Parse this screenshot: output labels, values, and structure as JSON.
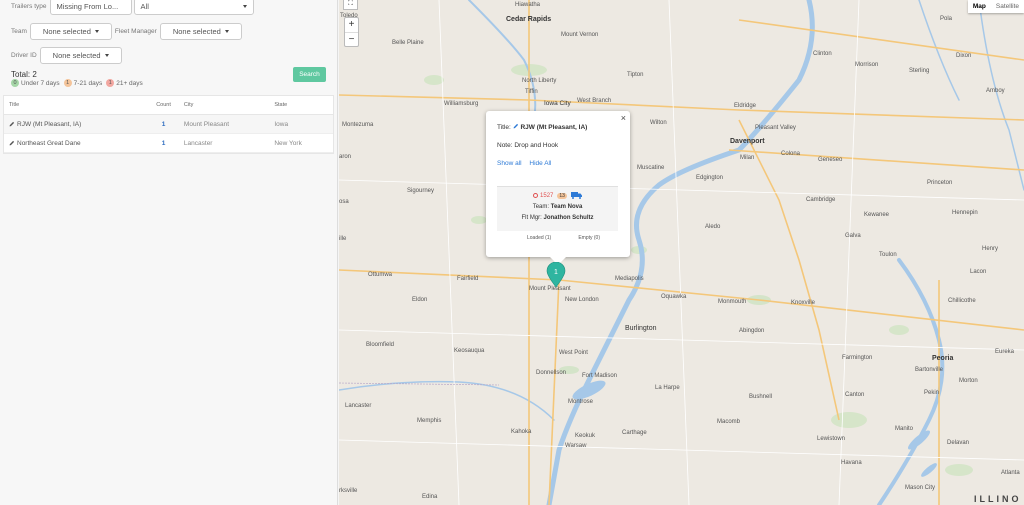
{
  "filters": {
    "trailers_type_label": "Trailers type",
    "trailers_type_value": "Missing From Lo...",
    "trailers_type_second_value": "All",
    "team_label": "Team",
    "team_value": "None selected",
    "fleet_manager_label": "Fleet Manager",
    "fleet_manager_value": "None selected",
    "driver_id_label": "Driver ID",
    "driver_id_value": "None selected",
    "search_button": "Search"
  },
  "summary": {
    "total": "Total: 2",
    "legend": [
      {
        "count": "0",
        "label": "Under 7 days"
      },
      {
        "count": "1",
        "label": "7-21 days"
      },
      {
        "count": "1",
        "label": "21+ days"
      }
    ]
  },
  "table": {
    "headers": [
      "Title",
      "Count",
      "City",
      "State"
    ],
    "rows": [
      {
        "title": "RJW (Mt Pleasant, IA)",
        "count": "1",
        "city": "Mount Pleasant",
        "state": "Iowa"
      },
      {
        "title": "Northeast Great Dane",
        "count": "1",
        "city": "Lancaster",
        "state": "New York"
      }
    ]
  },
  "map": {
    "map_button": "Map",
    "satellite_button": "Satellite",
    "zoom_in": "+",
    "zoom_out": "−",
    "fullscreen": "⛶",
    "pin_count": "1",
    "cities": {
      "hawatha": "Hiawatha",
      "cedar_rapids": "Cedar Rapids",
      "mount_vernon": "Mount Vernon",
      "belle_plaine": "Belle Plaine",
      "north_liberty": "North Liberty",
      "tiffin": "Tiffin",
      "iowa_city": "Iowa City",
      "west_branch": "West Branch",
      "tipton": "Tipton",
      "williamsburg": "Williamsburg",
      "montezuma": "Montezuma",
      "wilton": "Wilton",
      "eldridge": "Eldridge",
      "pleasant_valley": "Pleasant Valley",
      "davenport": "Davenport",
      "milan": "Milan",
      "colona": "Colona",
      "geneseo": "Geneseo",
      "muscatine": "Muscatine",
      "edgington": "Edgington",
      "sigourney": "Sigourney",
      "cambridge": "Cambridge",
      "kewanee": "Kewanee",
      "princeton": "Princeton",
      "hennepin": "Hennepin",
      "aledo": "Aledo",
      "galva": "Galva",
      "toulon": "Toulon",
      "henry": "Henry",
      "lacon": "Lacon",
      "ottumwa": "Ottumwa",
      "fairfield": "Fairfield",
      "mount_pleasant": "Mount Pleasant",
      "mediapolis": "Mediapolis",
      "new_london": "New London",
      "oquawka": "Oquawka",
      "monmouth": "Monmouth",
      "knoxville": "Knoxville",
      "chillicothe": "Chillicothe",
      "eldon": "Eldon",
      "burlington": "Burlington",
      "abingdon": "Abingdon",
      "bloomfield": "Bloomfield",
      "keosauqua": "Keosauqua",
      "west_point": "West Point",
      "farmington": "Farmington",
      "peoria": "Peoria",
      "eureka": "Eureka",
      "bartonville": "Bartonville",
      "donnellson": "Donnellson",
      "fort_madison": "Fort Madison",
      "la_harpe": "La Harpe",
      "canton": "Canton",
      "pekin": "Pekin",
      "morton": "Morton",
      "bushnell": "Bushnell",
      "montrose": "Montrose",
      "lancaster": "Lancaster",
      "memphis": "Memphis",
      "kahoka": "Kahoka",
      "keokuk": "Keokuk",
      "carthage": "Carthage",
      "macomb": "Macomb",
      "lewistown": "Lewistown",
      "manito": "Manito",
      "warsaw": "Warsaw",
      "delavan": "Delavan",
      "havana": "Havana",
      "edina": "Edina",
      "mason_city": "Mason City",
      "morrison": "Morrison",
      "sterling": "Sterling",
      "dixon": "Dixon",
      "amboy": "Amboy",
      "clinton": "Clinton",
      "pola": "Pola",
      "atlanta": "Atlanta",
      "kirksville": "rksville",
      "toledo": "Toledo",
      "illinois": "ILLINO",
      "aron": "aron",
      "osa": "osa",
      "ille": "ille"
    }
  },
  "infowindow": {
    "title_label": "Title:",
    "title_value": "RJW (Mt Pleasant, IA)",
    "note_label": "Note:",
    "note_value": "Drop and Hook",
    "show_all": "Show all",
    "hide_all": "Hide All",
    "close": "×",
    "trailer_id": "1527",
    "trailer_days": "13",
    "team_label": "Team:",
    "team_value": "Team Nova",
    "fleet_mgr_label": "Flt Mgr:",
    "fleet_mgr_value": "Jonathon Schultz",
    "loaded": "Loaded (1)",
    "empty": "Empty (0)"
  },
  "colors": {
    "accent": "#5fc8a0",
    "link": "#2d7ad6",
    "pin": "#2fb5a0",
    "water": "#a6c8e8",
    "map_land": "#ede9e2"
  }
}
